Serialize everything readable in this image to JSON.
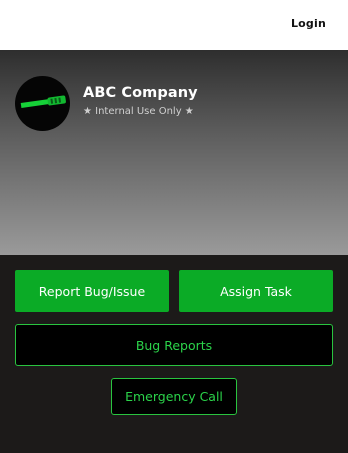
{
  "header": {
    "login_label": "Login"
  },
  "company": {
    "name": "ABC Company",
    "tagline": "★ Internal Use Only ★"
  },
  "actions": {
    "report_bug": "Report Bug/Issue",
    "assign_task": "Assign Task",
    "bug_reports": "Bug Reports",
    "emergency_call": "Emergency Call"
  },
  "colors": {
    "accent_green": "#0bab26",
    "outline_green": "#29c43f",
    "dark_background": "#1c1a19"
  }
}
